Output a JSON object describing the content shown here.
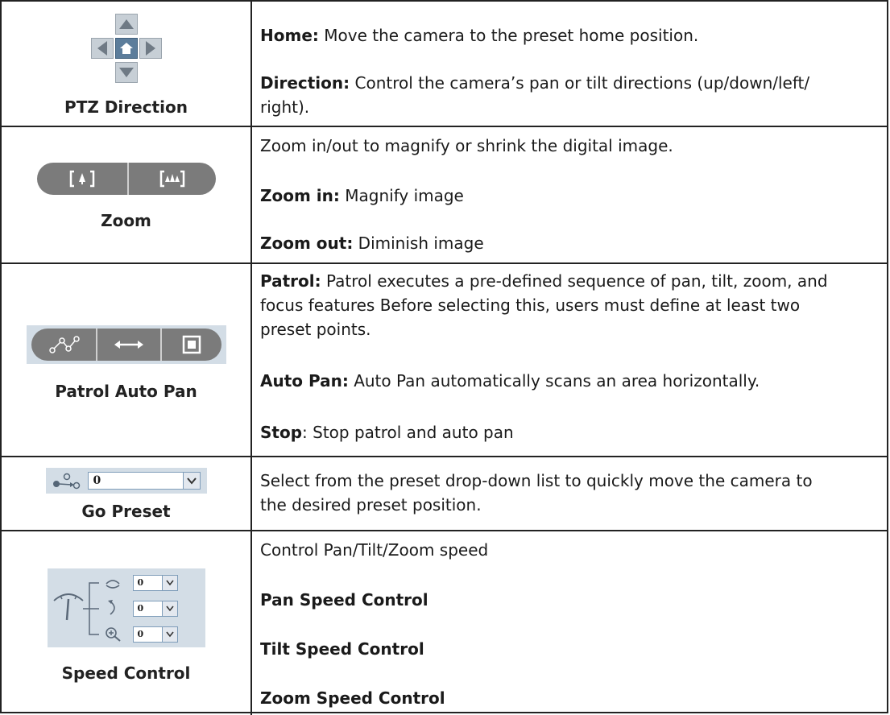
{
  "rows": [
    {
      "caption": "PTZ Direction",
      "items": [
        {
          "bold": "Home:",
          "text": " Move the camera to the preset home position."
        },
        {
          "bold": "Direction:",
          "text": " Control the camera’s pan or tilt directions (up/down/left/",
          "text2": "right)."
        }
      ]
    },
    {
      "caption": "Zoom",
      "intro": "Zoom in/out to magnify or shrink the digital image.",
      "items": [
        {
          "bold": "Zoom in:",
          "text": " Magnify image"
        },
        {
          "bold": "Zoom out:",
          "text": " Diminish image"
        }
      ]
    },
    {
      "caption": "Patrol Auto Pan",
      "items": [
        {
          "bold": "Patrol:",
          "text": " Patrol executes a pre-defined sequence of pan, tilt, zoom, and",
          "text2": "focus features Before selecting this, users must define at least two",
          "text3": "preset points."
        },
        {
          "bold": "Auto Pan:",
          "text": " Auto Pan automatically scans an area horizontally."
        },
        {
          "bold": "Stop",
          "text": ": Stop patrol and auto pan"
        }
      ]
    },
    {
      "caption": "Go Preset",
      "preset_value": "0",
      "text1": "Select from the preset drop-down list to quickly move the camera to",
      "text2": "the desired preset position."
    },
    {
      "caption": "Speed Control",
      "speed_values": [
        "0",
        "0",
        "0"
      ],
      "intro": "Control Pan/Tilt/Zoom speed",
      "items": [
        "Pan Speed Control",
        "Tilt Speed Control",
        "Zoom Speed Control"
      ]
    }
  ],
  "icons": {
    "ptz": [
      "arrow-up-icon",
      "arrow-left-icon",
      "home-icon",
      "arrow-right-icon",
      "arrow-down-icon"
    ],
    "zoom": [
      "zoom-in-icon",
      "zoom-out-icon"
    ],
    "patrol": [
      "patrol-icon",
      "auto-pan-icon",
      "stop-icon"
    ],
    "preset": [
      "go-preset-icon",
      "dropdown-arrow-icon"
    ],
    "speed": [
      "speed-gauge-icon",
      "pan-speed-icon",
      "tilt-speed-icon",
      "zoom-speed-icon"
    ]
  },
  "colors": {
    "control_gray": "#7b7b7b",
    "panel_blue": "#d3dde6",
    "border": "#222222"
  }
}
